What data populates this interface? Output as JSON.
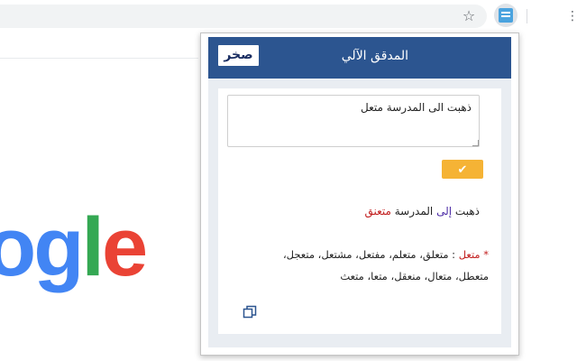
{
  "browser": {
    "star_icon": "star-icon",
    "extension_icon": "extension-icon",
    "menu_icon": "kebab-menu-icon"
  },
  "logo": {
    "visible_text_o": "o",
    "visible_text_g": "g",
    "visible_text_l": "l",
    "visible_text_e": "e",
    "colors": {
      "blue": "#4285f4",
      "green": "#34a853",
      "red": "#ea4335"
    }
  },
  "popup": {
    "brand_logo": "صخر",
    "title": "المدقق الآلي",
    "header_color": "#2c5590",
    "input": {
      "value": "ذهبت الى المدرسة متعل",
      "placeholder": ""
    },
    "check_button_icon": "✔",
    "check_button_color": "#f5b335",
    "result": {
      "word1": "ذهبت",
      "word2": "إلى",
      "word3": "المدرسة",
      "word4": "متعنق"
    },
    "suggestions": {
      "asterisk": "*",
      "wrong_word": "متعل",
      "colon": ":",
      "list_line1": "متعلق، متعلم، مفتعل، مشتعل، متعجل،",
      "list_line2": "متعطل، متعال، منعقل، متعا، متعث"
    },
    "copy_icon": "copy-icon"
  }
}
